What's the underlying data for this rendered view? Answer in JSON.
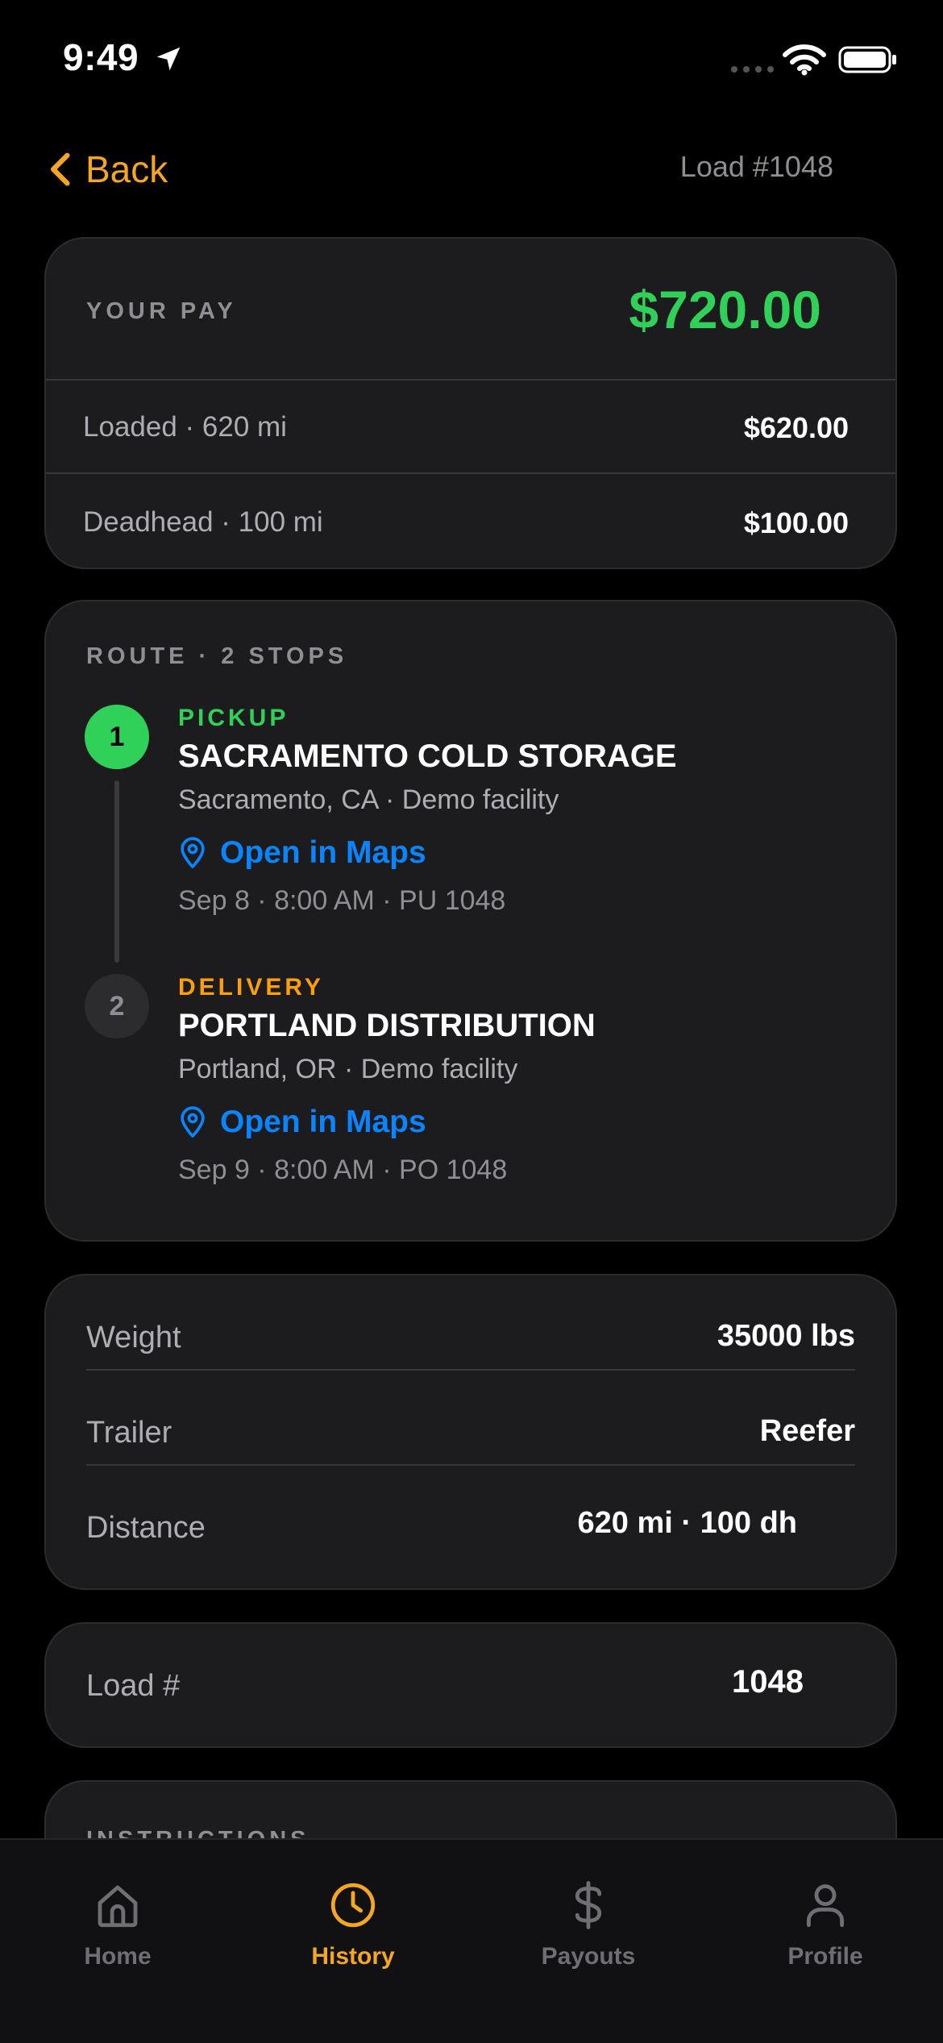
{
  "status_bar": {
    "time": "9:49",
    "icons": [
      "location-arrow-icon",
      "cellular-signal-icon",
      "wifi-icon",
      "battery-icon"
    ]
  },
  "nav": {
    "back_label": "Back",
    "title": "Load #1048"
  },
  "pay": {
    "label": "YOUR PAY",
    "total": "$720.00",
    "rows": [
      {
        "label": "Loaded · 620 mi",
        "value": "$620.00"
      },
      {
        "label": "Deadhead · 100 mi",
        "value": "$100.00"
      }
    ]
  },
  "route": {
    "label": "ROUTE · 2 STOPS",
    "stops": [
      {
        "number": "1",
        "type": "PICKUP",
        "name": "SACRAMENTO COLD STORAGE",
        "location": "Sacramento, CA · Demo facility",
        "maps_label": "Open in Maps",
        "time": "Sep 8 · 8:00 AM · PU 1048"
      },
      {
        "number": "2",
        "type": "DELIVERY",
        "name": "PORTLAND DISTRIBUTION",
        "location": "Portland, OR · Demo facility",
        "maps_label": "Open in Maps",
        "time": "Sep 9 · 8:00 AM · PO 1048"
      }
    ]
  },
  "details": [
    {
      "label": "Weight",
      "value": "35000 lbs"
    },
    {
      "label": "Trailer",
      "value": "Reefer"
    },
    {
      "label": "Distance",
      "value": "620 mi · 100 dh"
    }
  ],
  "load_number": {
    "label": "Load #",
    "value": "1048"
  },
  "instructions": {
    "label": "INSTRUCTIONS"
  },
  "tabbar": {
    "tabs": [
      {
        "label": "Home",
        "icon": "home-icon",
        "active": false
      },
      {
        "label": "History",
        "icon": "clock-icon",
        "active": true
      },
      {
        "label": "Payouts",
        "icon": "dollar-icon",
        "active": false
      },
      {
        "label": "Profile",
        "icon": "person-icon",
        "active": false
      }
    ]
  },
  "colors": {
    "accent": "#F5A623",
    "pay_green": "#30D158",
    "link_blue": "#0A84FF",
    "delivery_orange": "#FF9F0A",
    "card_bg": "#1C1C1E"
  }
}
